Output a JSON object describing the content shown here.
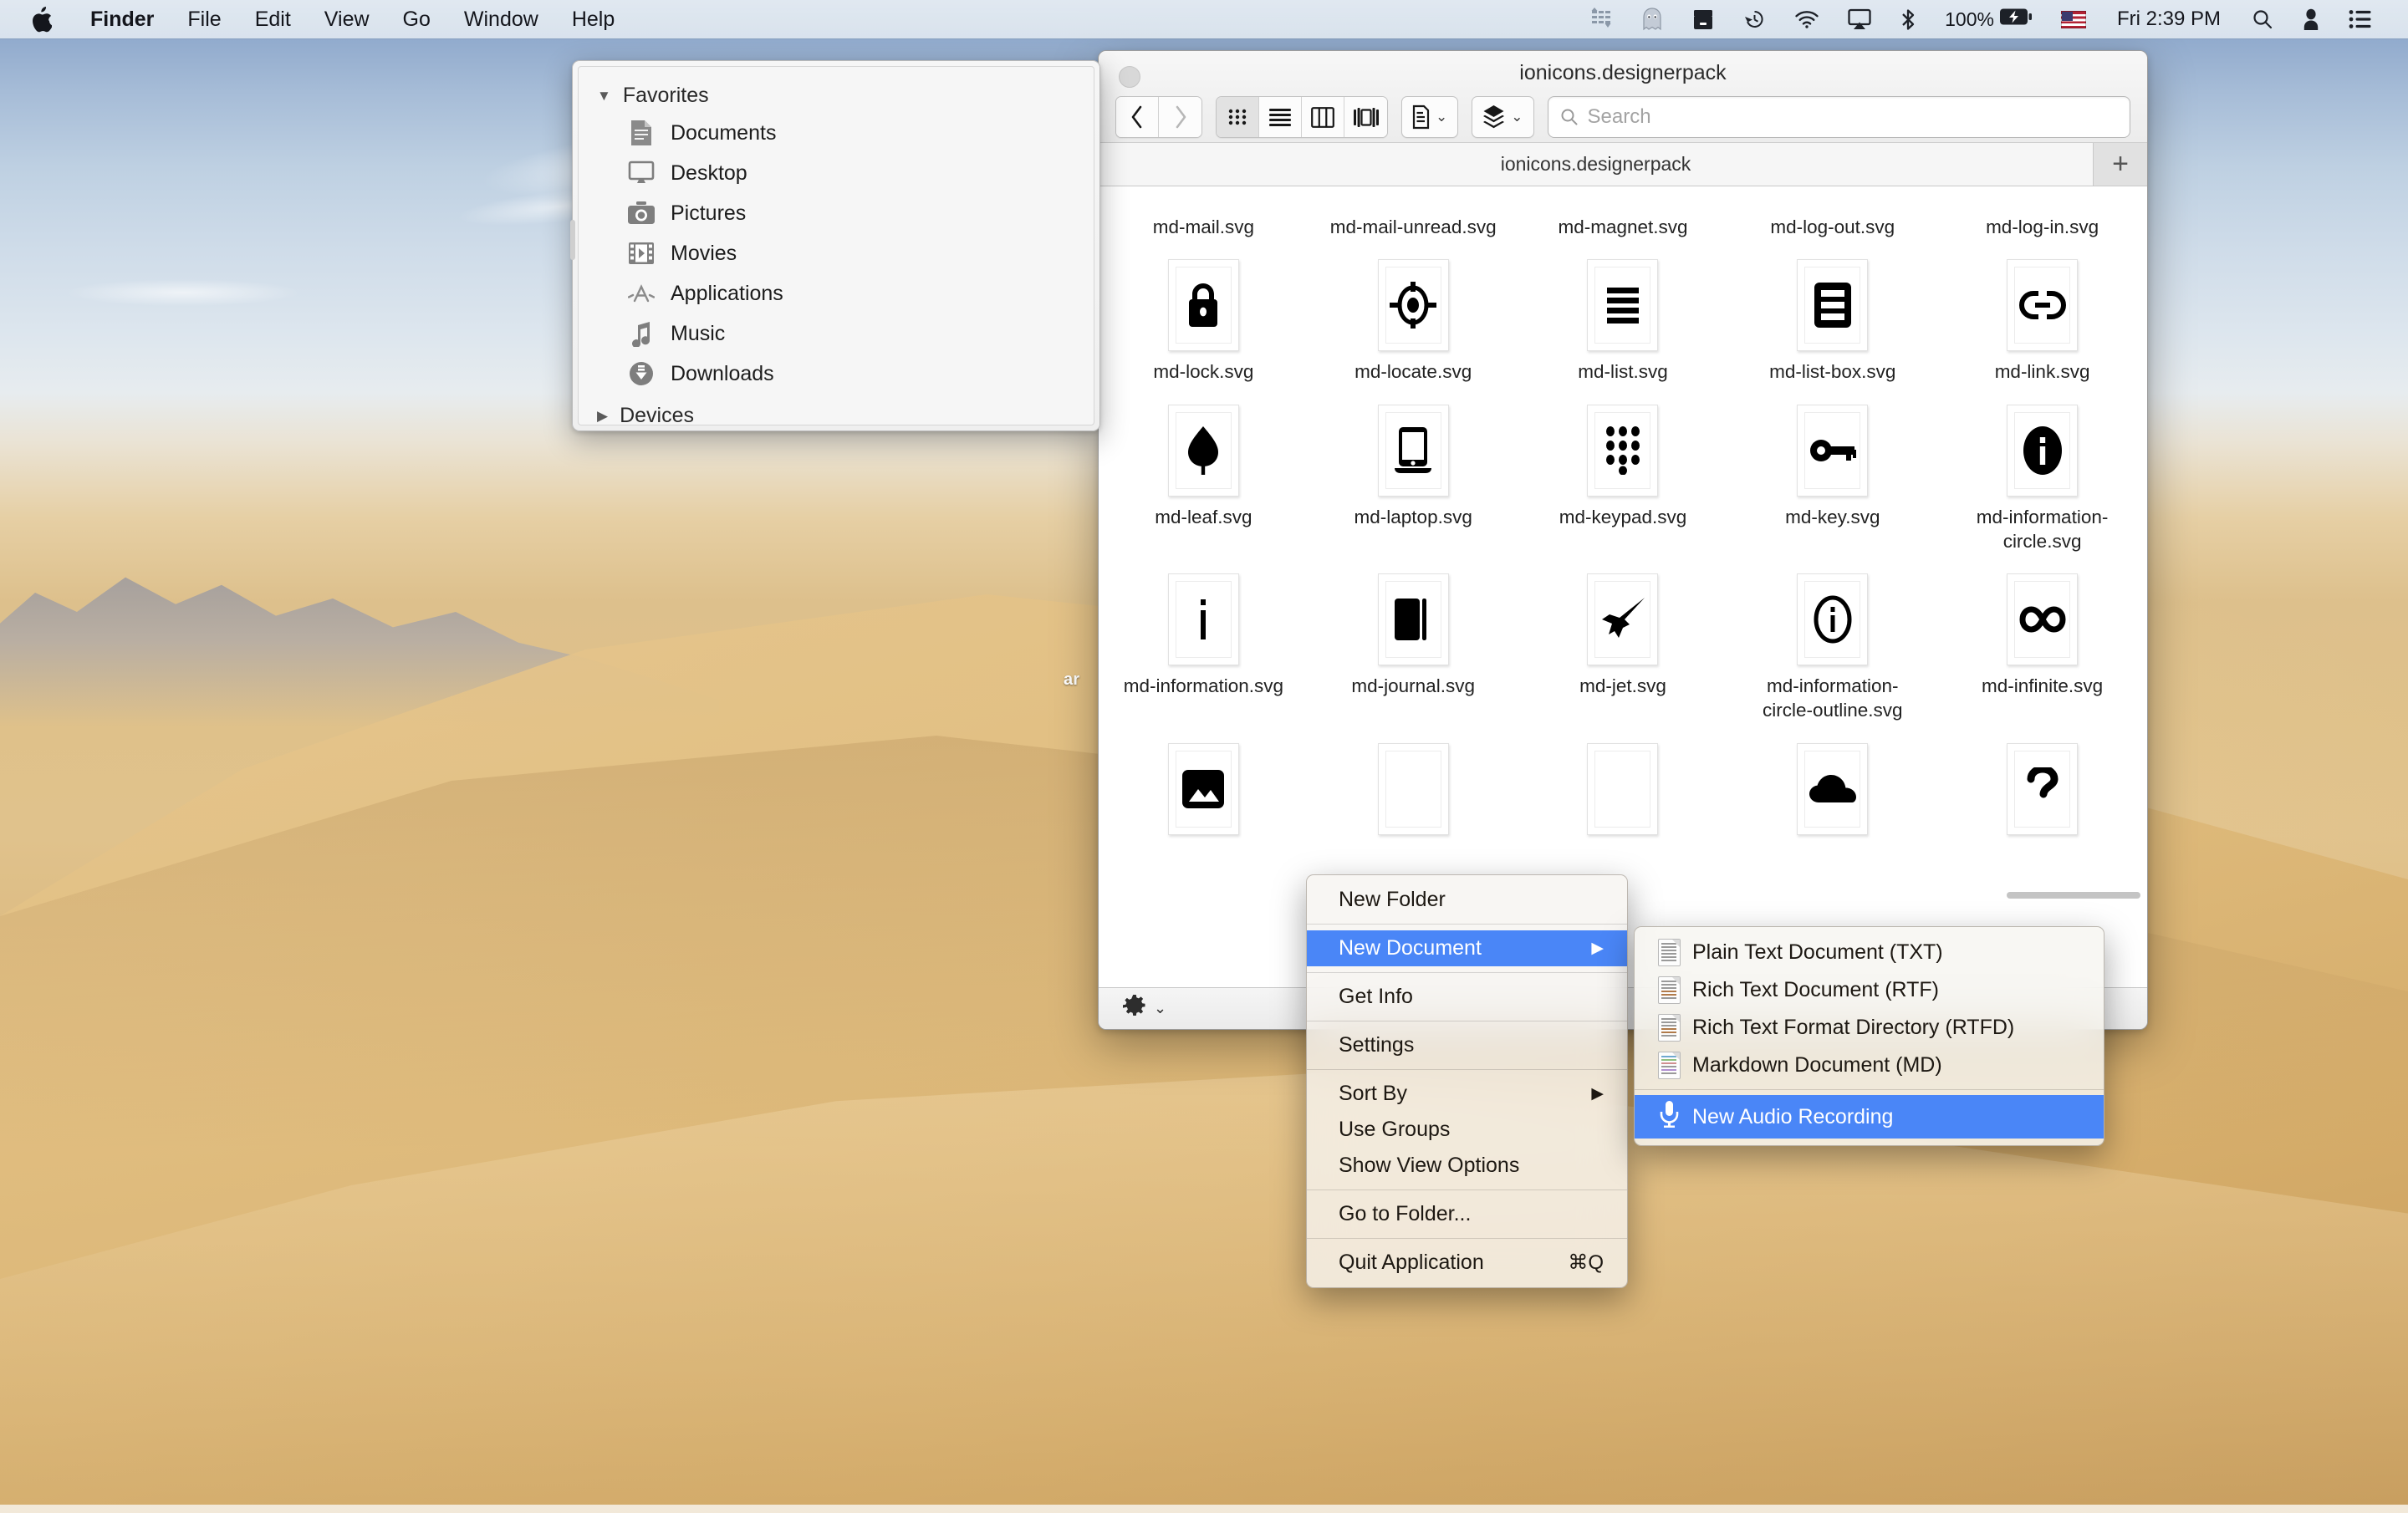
{
  "menubar": {
    "apple_icon": "apple-icon",
    "items": [
      {
        "label": "Finder",
        "bold": true
      },
      {
        "label": "File",
        "bold": false
      },
      {
        "label": "Edit",
        "bold": false
      },
      {
        "label": "View",
        "bold": false
      },
      {
        "label": "Go",
        "bold": false
      },
      {
        "label": "Window",
        "bold": false
      },
      {
        "label": "Help",
        "bold": false
      }
    ],
    "status_icons": [
      "equalizer-icon",
      "ghost-icon",
      "dropbox-icon",
      "time-machine-icon",
      "wifi-icon",
      "airplay-icon",
      "bluetooth-icon"
    ],
    "battery_percent": "100%",
    "battery_icon": "battery-charging-icon",
    "flag_icon": "us-flag-icon",
    "clock": "Fri 2:39 PM",
    "right_icons": [
      "search-icon",
      "user-icon",
      "control-center-icon"
    ]
  },
  "desktop": {
    "clipped_label": "ar"
  },
  "sidebar": {
    "favorites_label": "Favorites",
    "favorites_expanded": true,
    "items": [
      {
        "label": "Documents",
        "icon": "document-icon"
      },
      {
        "label": "Desktop",
        "icon": "monitor-icon"
      },
      {
        "label": "Pictures",
        "icon": "camera-icon"
      },
      {
        "label": "Movies",
        "icon": "film-icon"
      },
      {
        "label": "Applications",
        "icon": "appstore-icon"
      },
      {
        "label": "Music",
        "icon": "music-note-icon"
      },
      {
        "label": "Downloads",
        "icon": "download-icon"
      }
    ],
    "devices_label": "Devices",
    "devices_expanded": false
  },
  "finder": {
    "title": "ionicons.designerpack",
    "tab_label": "ionicons.designerpack",
    "new_tab_icon": "plus-icon",
    "nav": {
      "back_icon": "chevron-left-icon",
      "forward_icon": "chevron-right-icon"
    },
    "view_modes": [
      {
        "name": "icon-view",
        "icon": "grid-icon",
        "active": true
      },
      {
        "name": "list-view",
        "icon": "list-icon",
        "active": false
      },
      {
        "name": "column-view",
        "icon": "columns-icon",
        "active": false
      },
      {
        "name": "gallery-view",
        "icon": "gallery-icon",
        "active": false
      }
    ],
    "toolbar_buttons": [
      {
        "name": "arrange-button",
        "icon": "document-icon"
      },
      {
        "name": "action-button",
        "icon": "stack-icon"
      }
    ],
    "search": {
      "placeholder": "Search",
      "value": "",
      "icon": "search-icon"
    },
    "status_gear": {
      "icon": "gear-icon",
      "chevron": "chevron-down-icon"
    },
    "rows": [
      {
        "has_icons": false,
        "cells": [
          {
            "name": "md-mail.svg",
            "icon": "mail-icon"
          },
          {
            "name": "md-mail-unread.svg",
            "icon": "mail-unread-icon"
          },
          {
            "name": "md-magnet.svg",
            "icon": "magnet-icon"
          },
          {
            "name": "md-log-out.svg",
            "icon": "log-out-icon"
          },
          {
            "name": "md-log-in.svg",
            "icon": "log-in-icon"
          }
        ]
      },
      {
        "has_icons": true,
        "cells": [
          {
            "name": "md-lock.svg",
            "icon": "lock-icon"
          },
          {
            "name": "md-locate.svg",
            "icon": "locate-icon"
          },
          {
            "name": "md-list.svg",
            "icon": "list-icon"
          },
          {
            "name": "md-list-box.svg",
            "icon": "list-box-icon"
          },
          {
            "name": "md-link.svg",
            "icon": "link-icon"
          }
        ]
      },
      {
        "has_icons": true,
        "cells": [
          {
            "name": "md-leaf.svg",
            "icon": "leaf-icon"
          },
          {
            "name": "md-laptop.svg",
            "icon": "laptop-icon"
          },
          {
            "name": "md-keypad.svg",
            "icon": "keypad-icon"
          },
          {
            "name": "md-key.svg",
            "icon": "key-icon"
          },
          {
            "name": "md-information-circle.svg",
            "icon": "information-circle-icon"
          }
        ]
      },
      {
        "has_icons": true,
        "cells": [
          {
            "name": "md-information.svg",
            "icon": "information-icon"
          },
          {
            "name": "md-journal.svg",
            "icon": "journal-icon"
          },
          {
            "name": "md-jet.svg",
            "icon": "jet-icon"
          },
          {
            "name": "md-information-circle-outline.svg",
            "icon": "information-circle-outline-icon"
          },
          {
            "name": "md-infinite.svg",
            "icon": "infinite-icon"
          }
        ]
      },
      {
        "has_icons": true,
        "cells": [
          {
            "name": "",
            "icon": "image-icon"
          },
          {
            "name": "",
            "icon": "hidden-icon"
          },
          {
            "name": "",
            "icon": "hidden-icon"
          },
          {
            "name": "",
            "icon": "cloud-icon"
          },
          {
            "name": "",
            "icon": "help-icon"
          }
        ]
      }
    ]
  },
  "context_menu": {
    "items": [
      {
        "label": "New Folder",
        "submenu": false,
        "shortcut": "",
        "selected": false,
        "sep_after": true
      },
      {
        "label": "New Document",
        "submenu": true,
        "shortcut": "",
        "selected": true,
        "sep_after": true
      },
      {
        "label": "Get Info",
        "submenu": false,
        "shortcut": "",
        "selected": false,
        "sep_after": true
      },
      {
        "label": "Settings",
        "submenu": false,
        "shortcut": "",
        "selected": false,
        "sep_after": true
      },
      {
        "label": "Sort By",
        "submenu": true,
        "shortcut": "",
        "selected": false,
        "sep_after": false
      },
      {
        "label": "Use Groups",
        "submenu": false,
        "shortcut": "",
        "selected": false,
        "sep_after": false
      },
      {
        "label": "Show View Options",
        "submenu": false,
        "shortcut": "",
        "selected": false,
        "sep_after": true
      },
      {
        "label": "Go to Folder...",
        "submenu": false,
        "shortcut": "",
        "selected": false,
        "sep_after": true
      },
      {
        "label": "Quit Application",
        "submenu": false,
        "shortcut": "⌘Q",
        "selected": false,
        "sep_after": false
      }
    ],
    "submenu_arrow": "triangle-right-icon"
  },
  "submenu": {
    "items": [
      {
        "label": "Plain Text Document (TXT)",
        "icon": "txt-doc-icon",
        "selected": false,
        "sep_after": false
      },
      {
        "label": "Rich Text Document (RTF)",
        "icon": "rtf-doc-icon",
        "selected": false,
        "sep_after": false
      },
      {
        "label": "Rich Text Format Directory (RTFD)",
        "icon": "rtfd-doc-icon",
        "selected": false,
        "sep_after": false
      },
      {
        "label": "Markdown Document (MD)",
        "icon": "md-doc-icon",
        "selected": false,
        "sep_after": true
      },
      {
        "label": "New Audio Recording",
        "icon": "microphone-icon",
        "selected": true,
        "sep_after": false
      }
    ]
  },
  "colors": {
    "selection_blue": "#4a86f7",
    "menubar_bg": "#e4eaf1",
    "window_bg": "#ffffff"
  }
}
